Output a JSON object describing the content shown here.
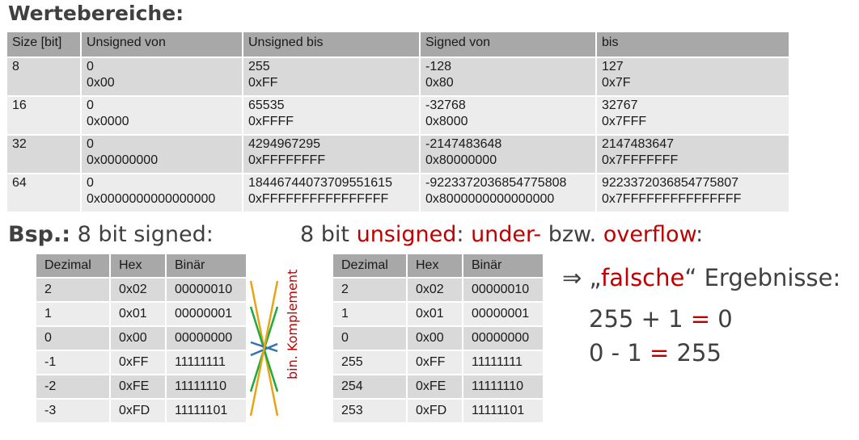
{
  "heading": "Wertebereiche:",
  "range_table": {
    "headers": [
      "Size [bit]",
      "Unsigned von",
      "Unsigned bis",
      "Signed von",
      "bis"
    ],
    "rows": [
      [
        [
          "8",
          ""
        ],
        [
          "0",
          "0x00"
        ],
        [
          "255",
          "0xFF"
        ],
        [
          "-128",
          "0x80"
        ],
        [
          "127",
          "0x7F"
        ]
      ],
      [
        [
          "16",
          ""
        ],
        [
          "0",
          "0x0000"
        ],
        [
          "65535",
          "0xFFFF"
        ],
        [
          "-32768",
          "0x8000"
        ],
        [
          "32767",
          "0x7FFF"
        ]
      ],
      [
        [
          "32",
          ""
        ],
        [
          "0",
          "0x00000000"
        ],
        [
          "4294967295",
          "0xFFFFFFFF"
        ],
        [
          "-2147483648",
          "0x80000000"
        ],
        [
          "2147483647",
          "0x7FFFFFFF"
        ]
      ],
      [
        [
          "64",
          ""
        ],
        [
          "0",
          "0x0000000000000000"
        ],
        [
          "18446744073709551615",
          "0xFFFFFFFFFFFFFFFF"
        ],
        [
          "-9223372036854775808",
          "0x8000000000000000"
        ],
        [
          "9223372036854775807",
          "0x7FFFFFFFFFFFFFFF"
        ]
      ]
    ]
  },
  "signed_title": {
    "bold": "Bsp.:",
    "rest": " 8 bit signed:"
  },
  "unsigned_title": {
    "p1": "8 bit ",
    "p2": "unsigned",
    "p3": ": ",
    "p4": "under-",
    "p5": " bzw. ",
    "p6": "overflow",
    "p7": ":"
  },
  "signed_table": {
    "headers": [
      "Dezimal",
      "Hex",
      "Binär"
    ],
    "rows": [
      [
        "2",
        "0x02",
        "00000010"
      ],
      [
        "1",
        "0x01",
        "00000001"
      ],
      [
        "0",
        "0x00",
        "00000000"
      ],
      [
        "-1",
        "0xFF",
        "11111111"
      ],
      [
        "-2",
        "0xFE",
        "11111110"
      ],
      [
        "-3",
        "0xFD",
        "11111101"
      ]
    ]
  },
  "unsigned_table": {
    "headers": [
      "Dezimal",
      "Hex",
      "Binär"
    ],
    "rows": [
      [
        "2",
        "0x02",
        "00000010"
      ],
      [
        "1",
        "0x01",
        "00000001"
      ],
      [
        "0",
        "0x00",
        "00000000"
      ],
      [
        "255",
        "0xFF",
        "11111111"
      ],
      [
        "254",
        "0xFE",
        "11111110"
      ],
      [
        "253",
        "0xFD",
        "11111101"
      ]
    ]
  },
  "komplement_label": "bin. Komplement",
  "result": {
    "arrow": "⇒ „",
    "word": "falsche",
    "rest": "“ Ergebnisse:"
  },
  "equations": [
    {
      "left": "255 + 1 ",
      "op": "=",
      "right": " 0"
    },
    {
      "left": "0 - 1 ",
      "op": "=",
      "right": " 255"
    }
  ],
  "colors": {
    "red": "#c00000",
    "arrow_orange": "#e8a317",
    "arrow_green": "#1faa3a",
    "arrow_blue": "#2f6fb5"
  }
}
